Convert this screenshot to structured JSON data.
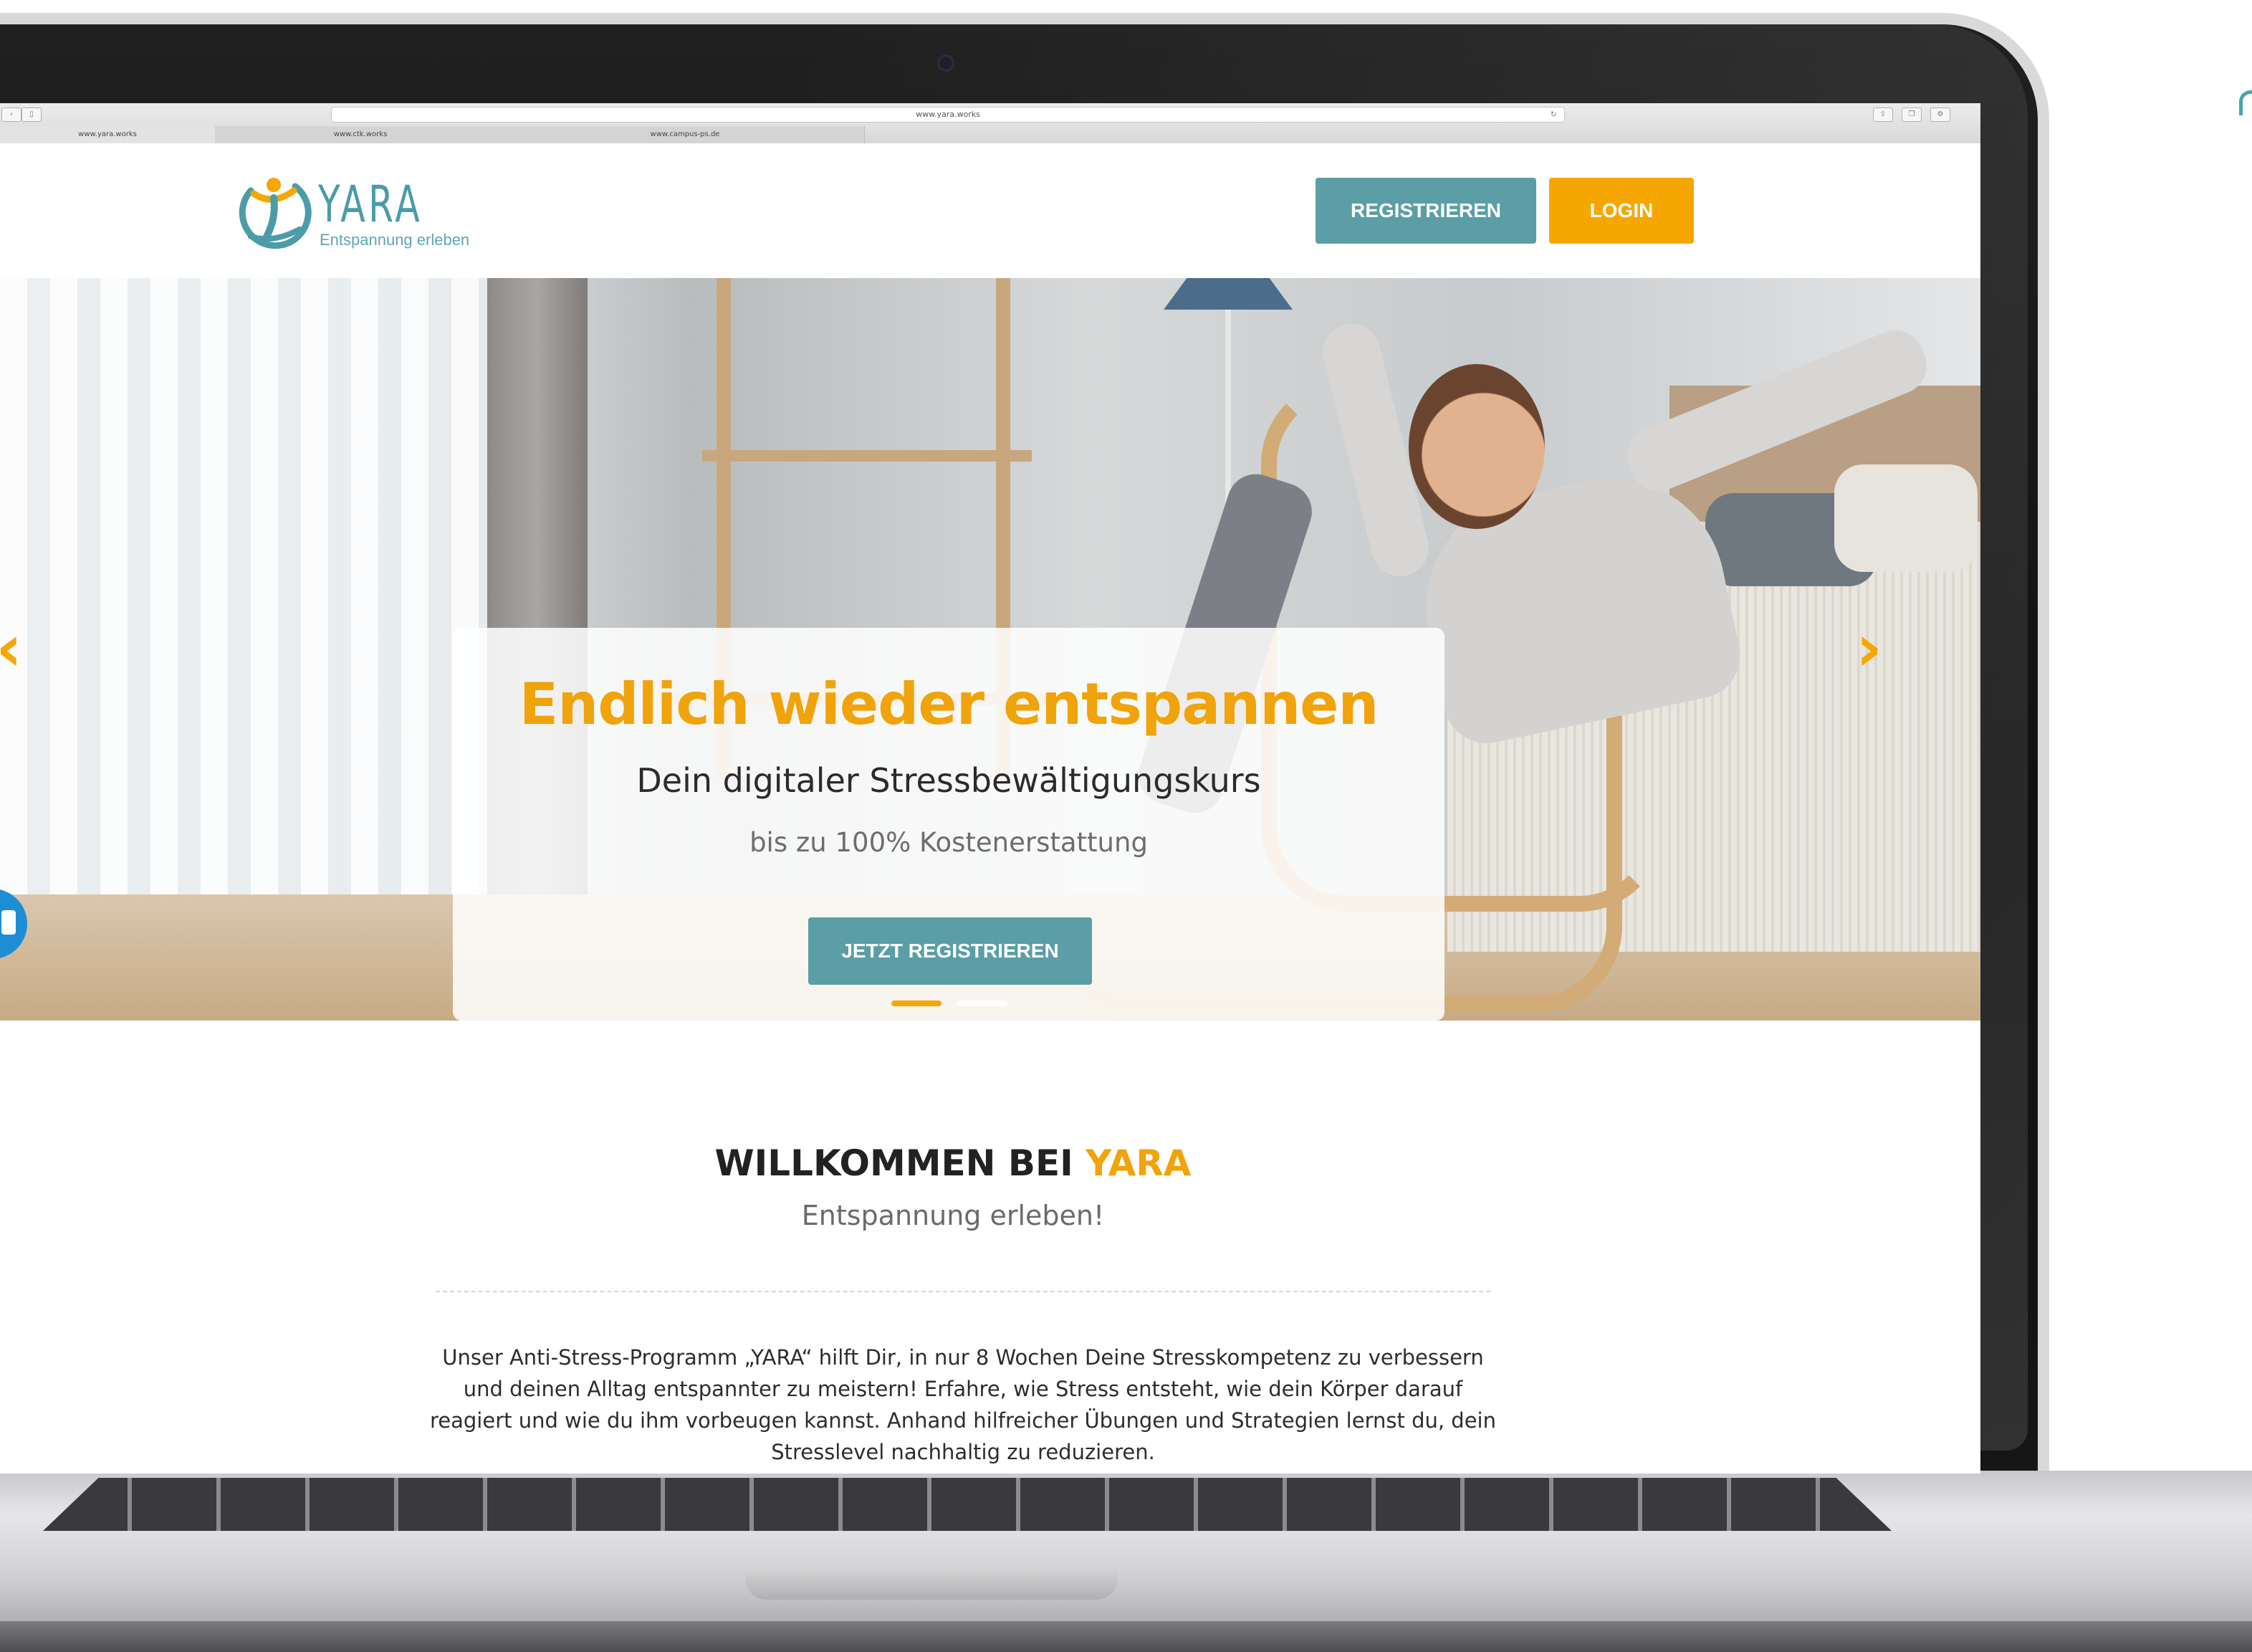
{
  "browser": {
    "url": "www.yara.works",
    "tabs": [
      "www.yara.works",
      "www.ctk.works",
      "www.campus-ps.de"
    ]
  },
  "header": {
    "logo_word": "YARA",
    "logo_tagline": "Entspannung erleben",
    "register_label": "REGISTRIEREN",
    "login_label": "LOGIN"
  },
  "hero": {
    "title": "Endlich wieder entspannen",
    "subtitle": "Dein digitaler Stressbewältigungskurs",
    "note": "bis zu 100% Kostenerstattung",
    "cta_label": "JETZT REGISTRIEREN",
    "prev_arrow": "‹",
    "next_arrow": "›",
    "slide_count": 2,
    "active_slide": 1
  },
  "welcome": {
    "title_prefix": "WILLKOMMEN BEI ",
    "title_accent": "YARA",
    "subtitle": "Entspannung erleben!",
    "body": "Unser Anti-Stress-Programm „YARA“ hilft Dir, in nur 8 Wochen Deine Stresskompetenz zu verbessern und deinen Alltag entspannter zu meistern! Erfahre, wie Stress entsteht, wie dein Körper darauf reagiert und wie du ihm vorbeugen kannst. Anhand hilfreicher Übungen und Strategien lernst du, dein Stresslevel nachhaltig zu reduzieren."
  },
  "colors": {
    "brand_teal": "#5b9ea6",
    "brand_orange": "#f5a700",
    "title_orange": "#f0a30a",
    "chat_blue": "#1d8ed6"
  },
  "icons": {
    "logo": "yara-figure-logo",
    "prev": "chevron-left-icon",
    "next": "chevron-right-icon",
    "chat": "chat-bubble-icon"
  }
}
